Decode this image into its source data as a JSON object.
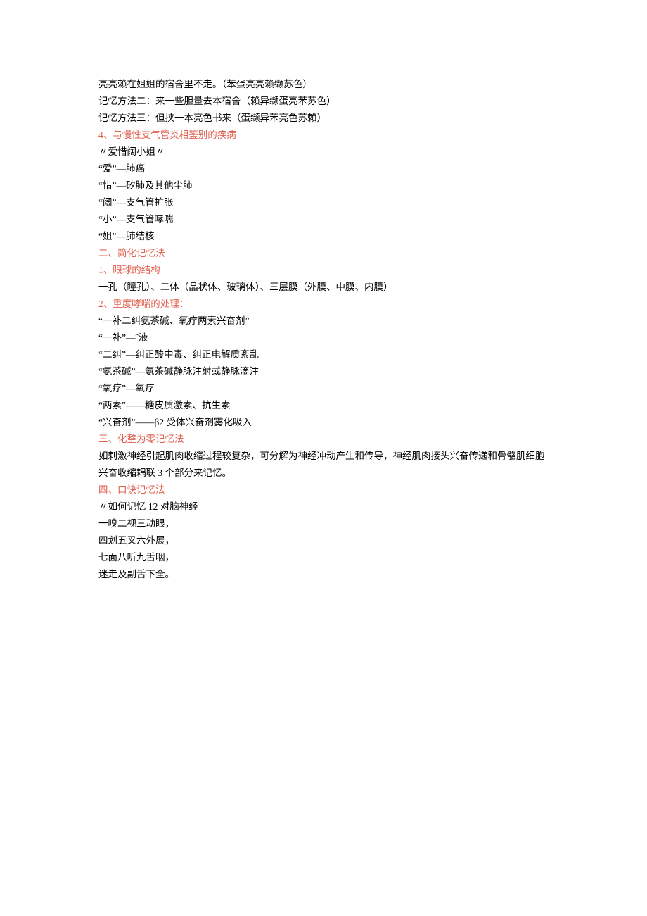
{
  "lines": [
    {
      "text": "亮亮赖在姐姐的宿舍里不走。（苯蛋亮亮赖缬苏色）",
      "color": "black"
    },
    {
      "text": "记忆方法二：来一些胆量去本宿舍（赖异缬蛋亮苯苏色）",
      "color": "black"
    },
    {
      "text": "记忆方法三：但挟一本亮色书来（蛋缬异苯亮色苏赖）",
      "color": "black"
    },
    {
      "text": "4、与慢性支气管炎相鉴别的疾病",
      "color": "red"
    },
    {
      "text": "〃爱惜阔小姐〃",
      "color": "black"
    },
    {
      "text": "“爱”—肺癌",
      "color": "black"
    },
    {
      "text": "“惜”—矽肺及其他尘肺",
      "color": "black"
    },
    {
      "text": "“阔”—支气管扩张",
      "color": "black"
    },
    {
      "text": "“小”—支气管哮喘",
      "color": "black"
    },
    {
      "text": "“姐”—肺结核",
      "color": "black"
    },
    {
      "text": "二、简化记忆法",
      "color": "red"
    },
    {
      "text": "1、眼球的结构",
      "color": "red"
    },
    {
      "text": "一孔（瞳孔）、二体（晶状体、玻璃体）、三层膜（外膜、中膜、内膜）",
      "color": "black"
    },
    {
      "text": "2、重度哮喘的处理：",
      "color": "red"
    },
    {
      "text": "“一补二纠氨茶碱、氧疗两素兴奋剂”",
      "color": "black"
    },
    {
      "text": "“一补”—ˆ液",
      "color": "black"
    },
    {
      "text": "“二纠”—纠正酸中毒、纠正电解质紊乱",
      "color": "black"
    },
    {
      "text": "“氨茶碱”—氨茶碱静脉注射或静脉滴注",
      "color": "black"
    },
    {
      "text": "“氧疗”—氧疗",
      "color": "black"
    },
    {
      "text": "“两素”——糖皮质激素、抗生素",
      "color": "black"
    },
    {
      "text": "“兴奋剂”——β2 受体兴奋剂雾化吸入",
      "color": "black"
    },
    {
      "text": "三、化整为零记忆法",
      "color": "red"
    },
    {
      "text": "如刺激神经引起肌肉收缩过程较复杂，可分解为神经冲动产生和传导，神经肌肉接头兴奋传递和骨骼肌细胞兴奋收缩耦联 3 个部分来记忆。",
      "color": "black"
    },
    {
      "text": "四、口诀记忆法",
      "color": "red"
    },
    {
      "text": "〃如何记忆 12 对脑神经",
      "color": "black"
    },
    {
      "text": "一嗅二视三动眼，",
      "color": "black"
    },
    {
      "text": "四划五叉六外展，",
      "color": "black"
    },
    {
      "text": "七面八听九舌咽，",
      "color": "black"
    },
    {
      "text": "迷走及副舌下全。",
      "color": "black"
    }
  ]
}
